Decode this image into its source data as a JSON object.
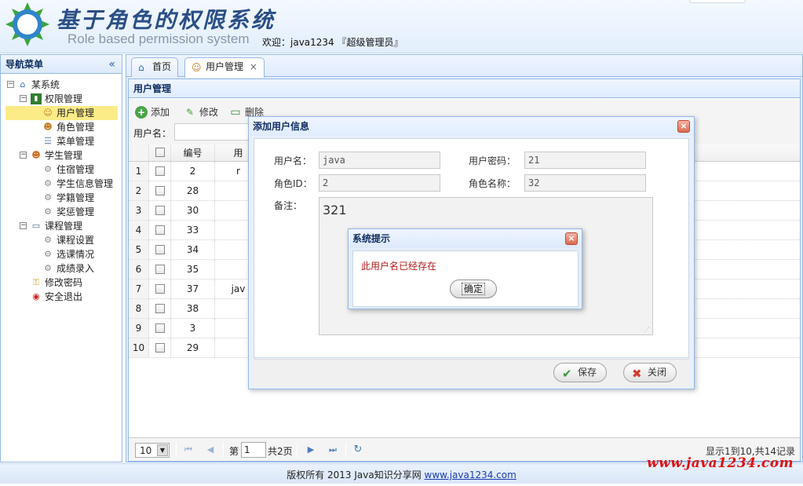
{
  "app": {
    "title_cn": "基于角色的权限系统",
    "title_en": "Role based permission system",
    "welcome": "欢迎：java1234 『超级管理员』"
  },
  "nav": {
    "title": "导航菜单",
    "collapse_icon": "«",
    "tree": [
      {
        "label": "某系统",
        "icon": "home-icon"
      },
      {
        "label": "权限管理",
        "icon": "book-icon"
      },
      {
        "label": "用户管理",
        "icon": "user-icon"
      },
      {
        "label": "角色管理",
        "icon": "users-icon"
      },
      {
        "label": "菜单管理",
        "icon": "menu-icon"
      },
      {
        "label": "学生管理",
        "icon": "group-icon"
      },
      {
        "label": "住宿管理",
        "icon": "gear-icon"
      },
      {
        "label": "学生信息管理",
        "icon": "gear-icon"
      },
      {
        "label": "学籍管理",
        "icon": "gear-icon"
      },
      {
        "label": "奖惩管理",
        "icon": "gear-icon"
      },
      {
        "label": "课程管理",
        "icon": "monitor-icon"
      },
      {
        "label": "课程设置",
        "icon": "gear-icon"
      },
      {
        "label": "选课情况",
        "icon": "gear-icon"
      },
      {
        "label": "成绩录入",
        "icon": "gear-icon"
      },
      {
        "label": "修改密码",
        "icon": "key-icon"
      },
      {
        "label": "安全退出",
        "icon": "exit-icon"
      }
    ]
  },
  "tabs": [
    {
      "label": "首页",
      "icon": "home-icon"
    },
    {
      "label": "用户管理",
      "icon": "user-icon",
      "close": "×"
    }
  ],
  "panel": {
    "title": "用户管理",
    "toolbar": {
      "add": "添加",
      "edit": "修改",
      "delete": "删除"
    },
    "search_label": "用户名："
  },
  "grid": {
    "columns": [
      "编号",
      "用"
    ],
    "rows": [
      {
        "num": "1",
        "id": "2",
        "name": "r"
      },
      {
        "num": "2",
        "id": "28",
        "name": ""
      },
      {
        "num": "3",
        "id": "30",
        "name": ""
      },
      {
        "num": "4",
        "id": "33",
        "name": ""
      },
      {
        "num": "5",
        "id": "34",
        "name": ""
      },
      {
        "num": "6",
        "id": "35",
        "name": ""
      },
      {
        "num": "7",
        "id": "37",
        "name": "jav"
      },
      {
        "num": "8",
        "id": "38",
        "name": ""
      },
      {
        "num": "9",
        "id": "3",
        "name": ""
      },
      {
        "num": "10",
        "id": "29",
        "name": ""
      }
    ]
  },
  "pager": {
    "page_size": "10",
    "page_prefix": "第",
    "page_value": "1",
    "page_suffix": "共2页",
    "info": "显示1到10,共14记录"
  },
  "dialog": {
    "title": "添加用户信息",
    "close": "×",
    "username_label": "用户名：",
    "username_value": "java",
    "password_label": "用户密码：",
    "password_value": "21",
    "roleid_label": "角色ID：",
    "roleid_value": "2",
    "rolename_label": "角色名称：",
    "rolename_value": "32",
    "remark_label": "备注：",
    "remark_value": "321",
    "save": "保存",
    "cancel": "关闭"
  },
  "message": {
    "title": "系统提示",
    "close": "×",
    "text": "此用户名已经存在",
    "ok": "确定"
  },
  "footer": {
    "text": "版权所有 2013 Java知识分享网 ",
    "link": "www.java1234.com"
  },
  "watermark": "www.java1234.com",
  "colors": {
    "accent": "#95b8e7",
    "selected_row": "#fbec88",
    "error_text": "#b31b1b",
    "watermark": "#e01010"
  }
}
